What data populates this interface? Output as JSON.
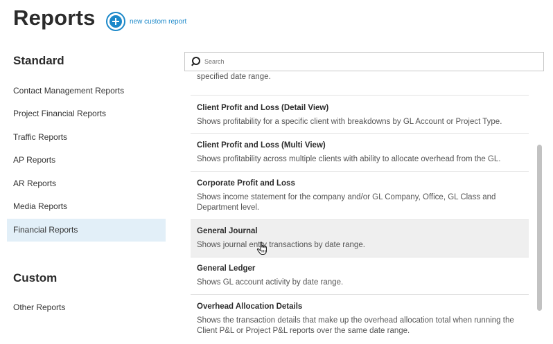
{
  "header": {
    "title": "Reports",
    "new_report_label": "new custom report"
  },
  "sidebar": {
    "standard_heading": "Standard",
    "standard_items": [
      {
        "label": "Contact Management Reports"
      },
      {
        "label": "Project Financial Reports"
      },
      {
        "label": "Traffic Reports"
      },
      {
        "label": "AP Reports"
      },
      {
        "label": "AR Reports"
      },
      {
        "label": "Media Reports"
      },
      {
        "label": "Financial Reports",
        "active": true
      }
    ],
    "custom_heading": "Custom",
    "custom_items": [
      {
        "label": "Other Reports"
      }
    ]
  },
  "search": {
    "placeholder": "Search"
  },
  "reports": [
    {
      "title": "",
      "description": "specified date range."
    },
    {
      "title": "Client Profit and Loss (Detail View)",
      "description": "Shows profitability for a specific client with breakdowns by GL Account or Project Type."
    },
    {
      "title": "Client Profit and Loss (Multi View)",
      "description": "Shows profitability across multiple clients with ability to allocate overhead from the GL."
    },
    {
      "title": "Corporate Profit and Loss",
      "description": "Shows income statement for the company and/or GL Company, Office, GL Class and Department level."
    },
    {
      "title": "General Journal",
      "description": "Shows journal entry transactions by date range.",
      "hovered": true
    },
    {
      "title": "General Ledger",
      "description": "Shows GL account activity by date range."
    },
    {
      "title": "Overhead Allocation Details",
      "description": "Shows the transaction details that make up the overhead allocation total when running the Client P&L or Project P&L reports over the same date range."
    }
  ],
  "colors": {
    "accent": "#1b88c9",
    "active_item_bg": "#e2eff8",
    "hover_row_bg": "#efefef"
  },
  "icons": {
    "add": "plus-circle-icon",
    "search": "search-icon",
    "cursor": "hand-pointer-icon"
  }
}
